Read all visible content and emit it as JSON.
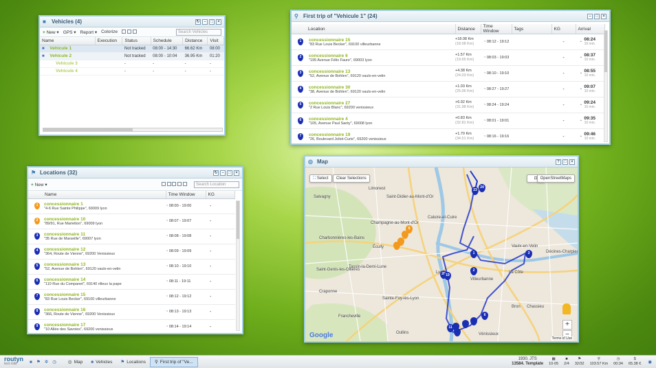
{
  "vehicles": {
    "title": "Vehicles (4)",
    "toolbar": {
      "new": "New",
      "gps": "GPS",
      "report": "Report",
      "colorize": "Colorize",
      "search": "Search Vehicles"
    },
    "columns": [
      "Name",
      "Execution",
      "Status",
      "Schedule",
      "Distance",
      "Visit"
    ],
    "rows": [
      {
        "name": "Vehicule 1",
        "status": "Not tracked",
        "schedule": "08:00 - 14:30",
        "distance": "66.62 Km",
        "visit": "08:00"
      },
      {
        "name": "Vehicule 2",
        "status": "Not tracked",
        "schedule": "08:00 - 10:04",
        "distance": "36.95 Km",
        "visit": "01:20"
      },
      {
        "name": "Vehicule 3",
        "status": "-",
        "schedule": "-",
        "distance": "-",
        "visit": "-"
      },
      {
        "name": "Vehicule 4",
        "status": "-",
        "schedule": "-",
        "distance": "-",
        "visit": "-"
      }
    ]
  },
  "trip": {
    "title": "First trip of \"Vehicule 1\" (24)",
    "columns": [
      "Location",
      "Distance",
      "Time Window",
      "Tags",
      "KG",
      "Arrival"
    ],
    "rows": [
      {
        "num": "1",
        "name": "concessionnaire 15",
        "addr": "\"83 Rue Louis Becker\", 69100 villeurbanne",
        "dist": "+18.08 Km",
        "total": "(18.08 Km)",
        "tw": "08:12 - 19:12",
        "kg": "-",
        "arr": "08:24",
        "wait": "10 min."
      },
      {
        "num": "2",
        "name": "concessionnaire 6",
        "addr": "\"195 Avenue Félix Faure\", 69003 lyon",
        "dist": "+1.57 Km",
        "total": "(19.65 Km)",
        "tw": "08:03 - 19:03",
        "kg": "-",
        "arr": "08:37",
        "wait": "10 min."
      },
      {
        "num": "3",
        "name": "concessionnaire 13",
        "addr": "\"52, Avenue de Bohlen\", 69120 vaulx-en-velin",
        "dist": "+4.38 Km",
        "total": "(24.03 Km)",
        "tw": "08:10 - 19:10",
        "kg": "-",
        "arr": "08:55",
        "wait": "10 min."
      },
      {
        "num": "4",
        "name": "concessionnaire 30",
        "addr": "\"38, Avenue de Bohlen\", 69120 vaulx-en-velin",
        "dist": "+1.03 Km",
        "total": "(25.06 Km)",
        "tw": "08:27 - 19:27",
        "kg": "-",
        "arr": "09:07",
        "wait": "10 min."
      },
      {
        "num": "5",
        "name": "concessionnaire 27",
        "addr": "\"2 Rue Louis Blanc\", 69200 venissieux",
        "dist": "+6.92 Km",
        "total": "(31.98 Km)",
        "tw": "08:24 - 19:24",
        "kg": "-",
        "arr": "09:24",
        "wait": "10 min."
      },
      {
        "num": "6",
        "name": "concessionnaire 4",
        "addr": "\"105, Avenue Paul Santy\", 69008 lyon",
        "dist": "+0.83 Km",
        "total": "(32.81 Km)",
        "tw": "08:01 - 19:01",
        "kg": "-",
        "arr": "09:35",
        "wait": "10 min."
      },
      {
        "num": "7",
        "name": "concessionnaire 19",
        "addr": "\"26, Boulevard Joliot-Curie\", 69200 venissieux",
        "dist": "+1.70 Km",
        "total": "(34.51 Km)",
        "tw": "08:16 - 19:16",
        "kg": "-",
        "arr": "09:46",
        "wait": "10 min."
      }
    ]
  },
  "locations": {
    "title": "Locations (32)",
    "toolbar": {
      "new": "New",
      "search": "Search Location"
    },
    "columns": [
      "Name",
      "Time Window",
      "KG"
    ],
    "rows": [
      {
        "num": "1",
        "name": "concessionnaire 1",
        "addr": "\"4-6 Rue Sainte Philippe\", 69009 lyon",
        "tw": "08:00 - 19:00",
        "kg": "-",
        "o": true
      },
      {
        "num": "2",
        "name": "concessionnaire 10",
        "addr": "\"89/91, Rue Marietton\", 69009 lyon",
        "tw": "08:07 - 19:07",
        "kg": "-",
        "o": true
      },
      {
        "num": "3",
        "name": "concessionnaire 11",
        "addr": "\"35 Rue de Marseille\", 69007 lyon",
        "tw": "08:08 - 19:08",
        "kg": "-",
        "o": false
      },
      {
        "num": "4",
        "name": "concessionnaire 12",
        "addr": "\"364, Route de Vienne\", 69200 Venissieux",
        "tw": "08:09 - 19:09",
        "kg": "-",
        "o": false
      },
      {
        "num": "5",
        "name": "concessionnaire 13",
        "addr": "\"52, Avenue de Bohlen\", 69120 vaulx-en-velin",
        "tw": "08:10 - 19:10",
        "kg": "-",
        "o": false
      },
      {
        "num": "6",
        "name": "concessionnaire 14",
        "addr": "\"110 Rue du Companet\", 69140 rilleux la pape",
        "tw": "08:11 - 19:11",
        "kg": "-",
        "o": false
      },
      {
        "num": "7",
        "name": "concessionnaire 15",
        "addr": "\"83 Rue Louis Becker\", 69100 villeurbanne",
        "tw": "08:12 - 19:12",
        "kg": "-",
        "o": false
      },
      {
        "num": "8",
        "name": "concessionnaire 16",
        "addr": "\"366, Route de Vienne\", 69200 Venissieux",
        "tw": "08:13 - 19:13",
        "kg": "-",
        "o": false
      },
      {
        "num": "9",
        "name": "concessionnaire 17",
        "addr": "\"10 Allée des Savoies\", 69200 venissieux",
        "tw": "08:14 - 19:14",
        "kg": "-",
        "o": false
      }
    ]
  },
  "map": {
    "title": "Map",
    "select": "Select",
    "clear": "Clear Selections",
    "osm": "OpenStreetMaps",
    "google": "Google",
    "terms": "Terms of Use",
    "labels": [
      "Salvagny",
      "Limonest",
      "Saint-Didier-au-Mont-d'Or",
      "Champagne-au-Mont-d'Or",
      "Caluire-et-Cuire",
      "Écully",
      "Tassin-la-Demi-Lune",
      "Lyon",
      "Villeurbanne",
      "Vaulx-en-Velin",
      "Bron",
      "Francheville",
      "Sainte-Foy-lès-Lyon",
      "Oullins",
      "Vénissieux",
      "Saint-Genis-les-Ollières",
      "Charbonnières-les-Bains",
      "Craponne",
      "La Côte",
      "Chassieu",
      "Décines-Charpieu"
    ]
  },
  "taskbar": {
    "brand": "routyn",
    "brand_sub": "test mite",
    "items": [
      "Map",
      "Vehicles",
      "Locations",
      "First trip of \"Ve..."
    ],
    "stats": [
      {
        "top": "1930. JTS",
        "bot": "13584. Template"
      },
      {
        "top": "",
        "bot": "10-05"
      },
      {
        "top": "",
        "bot": "2/4"
      },
      {
        "top": "",
        "bot": "32/32"
      },
      {
        "top": "",
        "bot": "103.57 Km"
      },
      {
        "top": "",
        "bot": "00:34"
      },
      {
        "top": "",
        "bot": "65.38 €"
      }
    ]
  },
  "colors": {
    "accent": "#8db51c",
    "pin": "#1a2eb3",
    "pin_orange": "#f39a1e",
    "frame": "#9fcfe6"
  }
}
